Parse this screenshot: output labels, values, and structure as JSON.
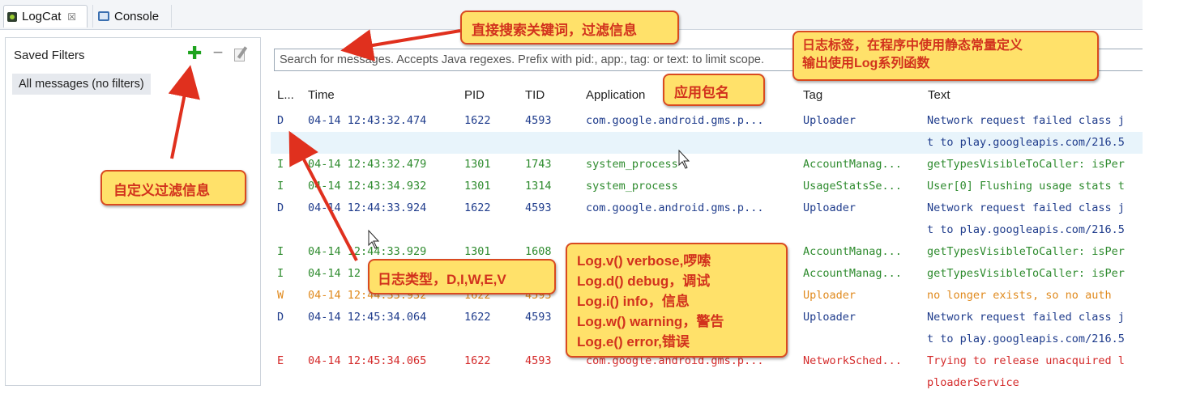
{
  "tabs": [
    {
      "label": "LogCat",
      "close_symbol": "☒"
    },
    {
      "label": "Console"
    }
  ],
  "sidebar": {
    "title": "Saved Filters",
    "add_symbol": "✚",
    "remove_symbol": "−",
    "filters": [
      "All messages (no filters)"
    ]
  },
  "search": {
    "placeholder": "Search for messages. Accepts Java regexes. Prefix with pid:, app:, tag: or text: to limit scope."
  },
  "columns": [
    "L...",
    "Time",
    "PID",
    "TID",
    "Application",
    "Tag",
    "Text"
  ],
  "rows": [
    {
      "level": "D",
      "time": "04-14 12:43:32.474",
      "pid": "1622",
      "tid": "4593",
      "app": "com.google.android.gms.p...",
      "tag": "Uploader",
      "text": "Network request failed class j"
    },
    {
      "level": "D",
      "time": "",
      "pid": "",
      "tid": "",
      "app": "",
      "tag": "",
      "text": "t to play.googleapis.com/216.5"
    },
    {
      "level": "I",
      "time": "04-14 12:43:32.479",
      "pid": "1301",
      "tid": "1743",
      "app": "system_process",
      "tag": "AccountManag...",
      "text": "getTypesVisibleToCaller: isPer"
    },
    {
      "level": "I",
      "time": "04-14 12:43:34.932",
      "pid": "1301",
      "tid": "1314",
      "app": "system_process",
      "tag": "UsageStatsSe...",
      "text": "User[0] Flushing usage stats t"
    },
    {
      "level": "D",
      "time": "04-14 12:44:33.924",
      "pid": "1622",
      "tid": "4593",
      "app": "com.google.android.gms.p...",
      "tag": "Uploader",
      "text": "Network request failed class j"
    },
    {
      "level": "D",
      "time": "",
      "pid": "",
      "tid": "",
      "app": "",
      "tag": "",
      "text": "t to play.googleapis.com/216.5"
    },
    {
      "level": "I",
      "time": "04-14 12:44:33.929",
      "pid": "1301",
      "tid": "1608",
      "app": "",
      "tag": "AccountManag...",
      "text": "getTypesVisibleToCaller: isPer"
    },
    {
      "level": "I",
      "time": "04-14 12",
      "pid": "",
      "tid": "",
      "app": "",
      "tag": "AccountManag...",
      "text": "getTypesVisibleToCaller: isPer"
    },
    {
      "level": "W",
      "time": "04-14 12:44:33.932",
      "pid": "1622",
      "tid": "4593",
      "app": "",
      "tag": "Uploader",
      "text": " no longer exists, so no auth"
    },
    {
      "level": "D",
      "time": "04-14 12:45:34.064",
      "pid": "1622",
      "tid": "4593",
      "app": "",
      "tag": "Uploader",
      "text": "Network request failed class j"
    },
    {
      "level": "D",
      "time": "",
      "pid": "",
      "tid": "",
      "app": "",
      "tag": "",
      "text": "t to play.googleapis.com/216.5"
    },
    {
      "level": "E",
      "time": "04-14 12:45:34.065",
      "pid": "1622",
      "tid": "4593",
      "app": "com.google.android.gms.p...",
      "tag": "NetworkSched...",
      "text": "Trying to release unacquired l"
    },
    {
      "level": "E",
      "time": "",
      "pid": "",
      "tid": "",
      "app": "",
      "tag": "",
      "text": "ploaderService"
    }
  ],
  "annotations": {
    "search_note": "直接搜索关键词，过滤信息",
    "tag_note": [
      "日志标签，在程序中使用静态常量定义",
      "输出使用Log系列函数"
    ],
    "app_note": "应用包名",
    "filter_note": "自定义过滤信息",
    "level_note": "日志类型，D,I,W,E,V",
    "methods_note": [
      "Log.v()   verbose,啰嗦",
      "Log.d()   debug，调试",
      "Log.i()   info，信息",
      "Log.w()   warning，警告",
      "Log.e()   error,错误"
    ]
  },
  "colors": {
    "debug": "#1f3c8c",
    "info": "#2e8b2e",
    "warning": "#e08a1e",
    "error": "#d42a2a",
    "callout_bg": "#ffe16a",
    "callout_text": "#d2321d"
  }
}
